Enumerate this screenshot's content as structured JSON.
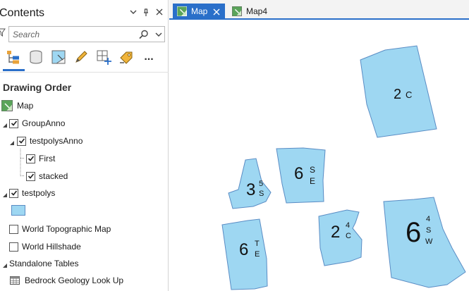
{
  "contents_pane": {
    "title": "Contents",
    "search": {
      "placeholder": "Search"
    },
    "toolbar": {
      "tools": [
        {
          "name": "list-by-drawing-order",
          "icon": "drawing-order-icon"
        },
        {
          "name": "list-by-data-source",
          "icon": "data-source-icon"
        },
        {
          "name": "list-by-selection",
          "icon": "selection-icon"
        },
        {
          "name": "list-by-editing",
          "icon": "pencil-icon"
        },
        {
          "name": "list-by-snapping",
          "icon": "snapping-icon"
        },
        {
          "name": "list-by-labeling",
          "icon": "label-tag-icon"
        },
        {
          "name": "more",
          "icon": "more-icon",
          "label": "..."
        }
      ]
    },
    "section_title": "Drawing Order",
    "layers": {
      "map": "Map",
      "group_anno": "GroupAnno",
      "testpolys_anno": "testpolysAnno",
      "first": "First",
      "stacked": "stacked",
      "testpolys": "testpolys",
      "world_topographic": "World Topographic Map",
      "world_hillshade": "World Hillshade"
    },
    "standalone_tables": {
      "title": "Standalone Tables",
      "items": [
        "Bedrock Geology Look Up"
      ]
    }
  },
  "tabs": [
    {
      "label": "Map",
      "active": true
    },
    {
      "label": "Map4",
      "active": false
    }
  ],
  "map": {
    "polygon_fill": "#9ed7f2",
    "polygon_stroke": "#5a8cc4",
    "annotations": [
      {
        "main": "2",
        "sub": "C"
      },
      {
        "main": "6",
        "sub_top": "S",
        "sub_bottom": "E"
      },
      {
        "main": "3",
        "sub_top": "5",
        "sub_bottom": "S"
      },
      {
        "main": "6",
        "sub_top": "T",
        "sub_bottom": "E"
      },
      {
        "main": "2",
        "sub_top": "4",
        "sub_bottom": "C"
      },
      {
        "main": "6",
        "sub_top": "4",
        "sub_mid": "S",
        "sub_bottom": "W"
      }
    ]
  },
  "colors": {
    "accent": "#2a6fc9",
    "checkbox_border": "#555555"
  }
}
